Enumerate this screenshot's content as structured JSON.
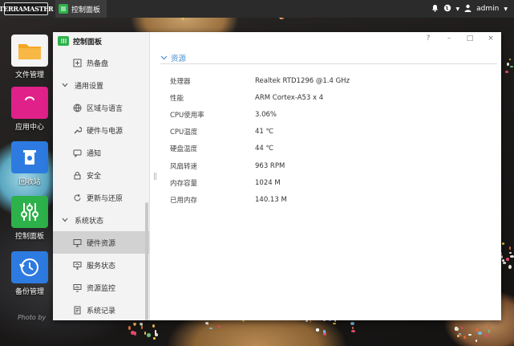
{
  "topbar": {
    "logo": "TERRAMASTER",
    "active_tab_label": "控制面板",
    "user": "admin"
  },
  "desktop": {
    "icons": [
      {
        "label": "文件管理",
        "icon": "folder-icon",
        "color": "#f5a623"
      },
      {
        "label": "应用中心",
        "icon": "shopping-bag-icon",
        "color": "#e0218a"
      },
      {
        "label": "回收站",
        "icon": "recycle-bin-icon",
        "color": "#2d7be0"
      },
      {
        "label": "控制面板",
        "icon": "sliders-icon",
        "color": "#2db14a"
      },
      {
        "label": "备份管理",
        "icon": "clock-backup-icon",
        "color": "#2d7be0"
      }
    ],
    "watermark": "Photo by"
  },
  "window": {
    "title": "控制面板",
    "controls": [
      "?",
      "–",
      "□",
      "×"
    ],
    "nav": [
      {
        "type": "item",
        "label": "热备盘",
        "icon": "hot-spare-icon"
      },
      {
        "type": "group",
        "label": "通用设置",
        "icon": "chevron-down-icon"
      },
      {
        "type": "item",
        "label": "区域与语言",
        "icon": "globe-icon"
      },
      {
        "type": "item",
        "label": "硬件与电源",
        "icon": "wrench-icon"
      },
      {
        "type": "item",
        "label": "通知",
        "icon": "chat-icon"
      },
      {
        "type": "item",
        "label": "安全",
        "icon": "lock-icon"
      },
      {
        "type": "item",
        "label": "更新与还原",
        "icon": "refresh-icon"
      },
      {
        "type": "group",
        "label": "系统状态",
        "icon": "chevron-down-icon"
      },
      {
        "type": "item",
        "label": "硬件资源",
        "icon": "monitor-icon",
        "active": true
      },
      {
        "type": "item",
        "label": "服务状态",
        "icon": "service-icon"
      },
      {
        "type": "item",
        "label": "资源监控",
        "icon": "monitor-chart-icon"
      },
      {
        "type": "item",
        "label": "系统记录",
        "icon": "log-icon"
      }
    ],
    "section_title": "资源",
    "resources": [
      {
        "label": "处理器",
        "value": "Realtek RTD1296 @1.4 GHz"
      },
      {
        "label": "性能",
        "value": "ARM Cortex-A53 x 4"
      },
      {
        "label": "CPU使用率",
        "value": "3.06%"
      },
      {
        "label": "CPU温度",
        "value": "41 ℃"
      },
      {
        "label": "硬盘温度",
        "value": "44 ℃"
      },
      {
        "label": "风扇转速",
        "value": "963 RPM"
      },
      {
        "label": "内存容量",
        "value": "1024 M"
      },
      {
        "label": "已用内存",
        "value": "140.13 M"
      }
    ]
  }
}
